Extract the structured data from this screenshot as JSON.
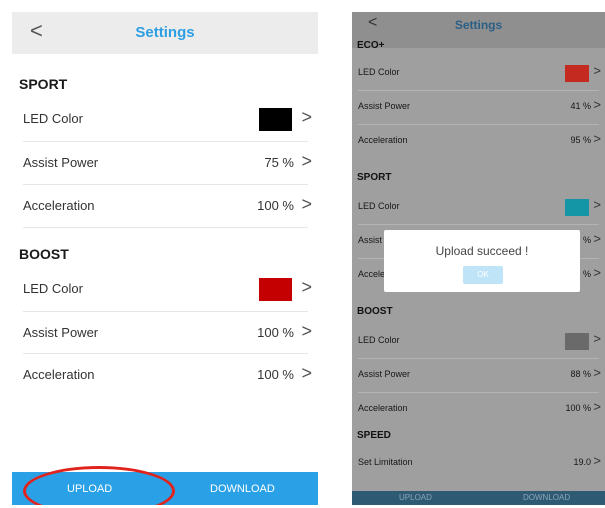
{
  "left": {
    "header": {
      "back_icon": "chevron-left-icon",
      "back_glyph": "<",
      "title": "Settings"
    },
    "sport": {
      "title": "SPORT",
      "led_label": "LED Color",
      "led_color": "#000000",
      "assist_label": "Assist Power",
      "assist_value": "75 %",
      "accel_label": "Acceleration",
      "accel_value": "100 %"
    },
    "boost": {
      "title": "BOOST",
      "led_label": "LED Color",
      "led_color": "#c40000",
      "assist_label": "Assist Power",
      "assist_value": "100 %",
      "accel_label": "Acceleration",
      "accel_value": "100 %"
    },
    "chevron_glyph": ">",
    "footer": {
      "upload_label": "UPLOAD",
      "download_label": "DOWNLOAD"
    }
  },
  "right": {
    "header": {
      "back_glyph": "<",
      "title": "Settings"
    },
    "ecoplus": {
      "title": "ECO+",
      "led_label": "LED Color",
      "led_color": "#c52a20",
      "assist_label": "Assist Power",
      "assist_value": "41 %",
      "accel_label": "Acceleration",
      "accel_value": "95 %"
    },
    "sport": {
      "title": "SPORT",
      "led_label": "LED Color",
      "led_color": "#1596a6",
      "assist_label": "Assist",
      "assist_value": "%",
      "accel_label": "Accele",
      "accel_value": "%"
    },
    "boost": {
      "title": "BOOST",
      "led_label": "LED Color",
      "led_color": "#6a6a6a",
      "assist_label": "Assist Power",
      "assist_value": "88 %",
      "accel_label": "Acceleration",
      "accel_value": "100 %"
    },
    "speed": {
      "title": "SPEED",
      "limit_label": "Set Limitation",
      "limit_value": "19.0"
    },
    "chevron_glyph": ">",
    "dialog": {
      "message": "Upload succeed !",
      "ok_label": "OK"
    },
    "footer": {
      "upload_label": "UPLOAD",
      "download_label": "DOWNLOAD"
    }
  }
}
